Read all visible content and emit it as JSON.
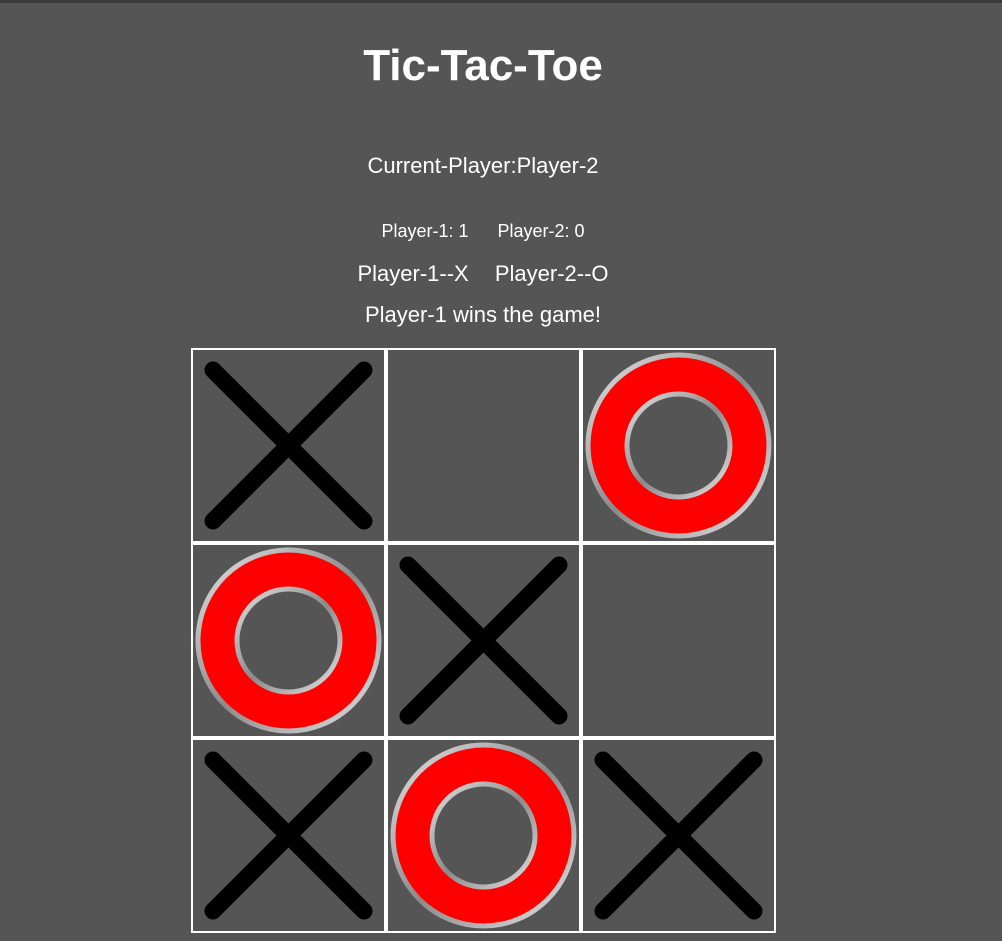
{
  "title": "Tic-Tac-Toe",
  "status": {
    "current_player": "Current-Player:Player-2",
    "result": "Player-1 wins the game!"
  },
  "scores": {
    "player1": "Player-1: 1",
    "player2": "Player-2: 0"
  },
  "symbols": {
    "player1": "Player-1--X",
    "player2": "Player-2--O"
  },
  "board": [
    [
      "X",
      "",
      "O"
    ],
    [
      "O",
      "X",
      ""
    ],
    [
      "X",
      "O",
      "X"
    ]
  ],
  "colors": {
    "background": "#555555",
    "grid_lines": "#ffffff",
    "x_mark": "#000000",
    "o_mark": "#ff0000",
    "o_rim": "#c0c0c0"
  }
}
